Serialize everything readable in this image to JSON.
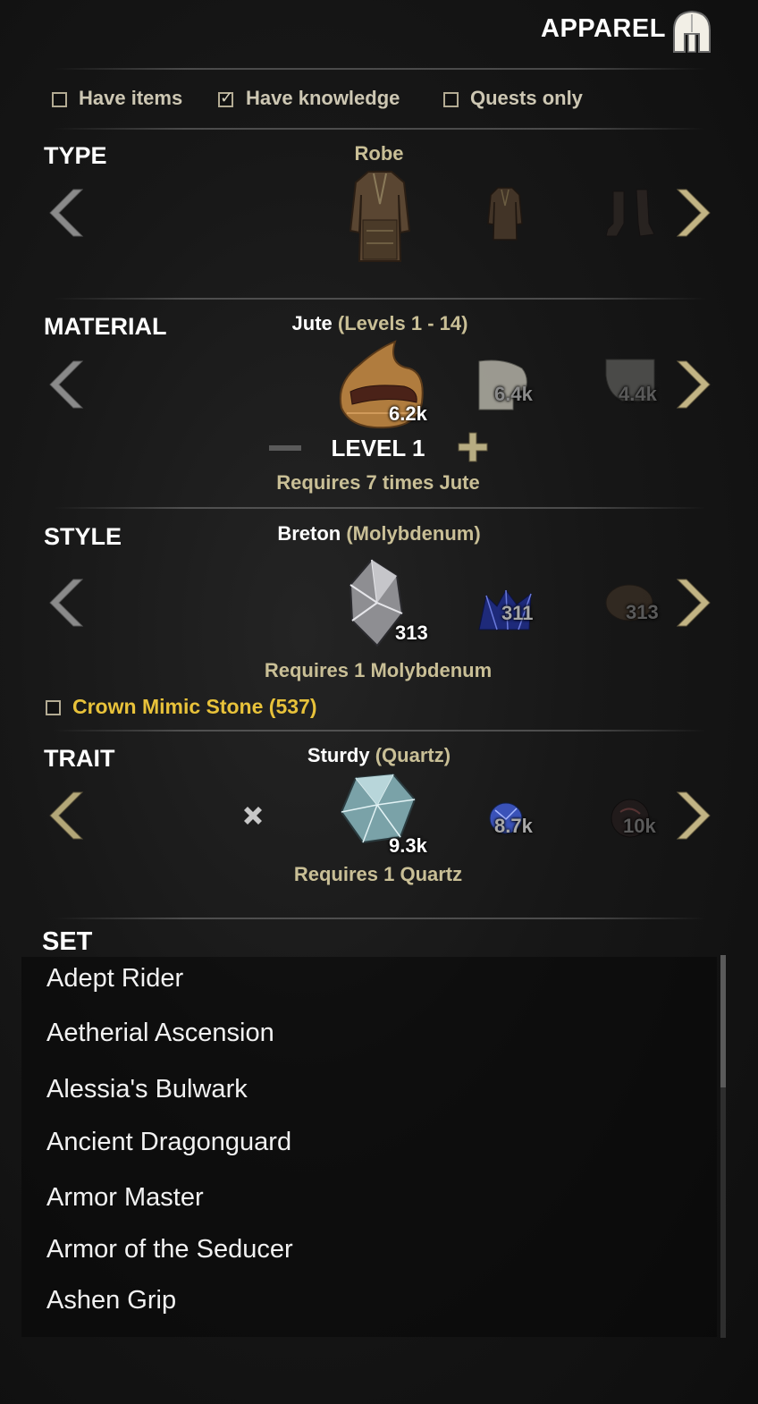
{
  "header": {
    "title": "APPAREL",
    "icon": "helmet-icon"
  },
  "filters": [
    {
      "label": "Have items",
      "checked": false
    },
    {
      "label": "Have knowledge",
      "checked": true
    },
    {
      "label": "Quests only",
      "checked": false
    }
  ],
  "type": {
    "heading": "TYPE",
    "selected_name": "Robe",
    "options": [
      "robe-icon",
      "jerkin-icon",
      "shoes-icon"
    ]
  },
  "material": {
    "heading": "MATERIAL",
    "selected_name": "Jute",
    "selected_detail": "(Levels 1 - 14)",
    "counts": [
      "6.2k",
      "6.4k",
      "4.4k"
    ],
    "level": "LEVEL 1",
    "requirement": "Requires 7 times Jute"
  },
  "style": {
    "heading": "STYLE",
    "selected_name": "Breton",
    "selected_detail": "(Molybdenum)",
    "counts": [
      "313",
      "311",
      "313"
    ],
    "requirement": "Requires 1 Molybdenum",
    "crown_mimic_label": "Crown Mimic Stone (537)",
    "crown_mimic_checked": false
  },
  "trait": {
    "heading": "TRAIT",
    "selected_name": "Sturdy",
    "selected_detail": "(Quartz)",
    "counts": [
      "9.3k",
      "8.7k",
      "10k"
    ],
    "requirement": "Requires 1 Quartz"
  },
  "set": {
    "heading": "SET",
    "items": [
      "Adept Rider",
      "Aetherial Ascension",
      "Alessia's Bulwark",
      "Ancient Dragonguard",
      "Armor Master",
      "Armor of the Seducer",
      "Ashen Grip"
    ]
  },
  "colors": {
    "accent_tan": "#c9bf96",
    "crown_gold": "#e8c23a",
    "text_white": "#ffffff"
  }
}
